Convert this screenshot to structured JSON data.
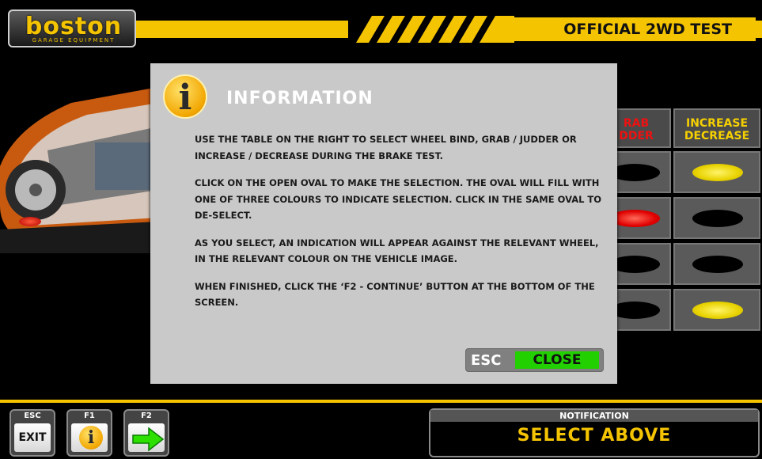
{
  "header": {
    "brand": "boston",
    "brand_sub": "GARAGE EQUIPMENT",
    "title": "OFFICIAL 2WD TEST"
  },
  "table": {
    "headers": [
      "GRAB\nJUDDER",
      "INCREASE\nDECREASE"
    ],
    "header_visible": [
      "RAB\nDDER",
      "INCREASE\nDECREASE"
    ],
    "rows": [
      {
        "grab_judder": "black",
        "increase_decrease": "yellow"
      },
      {
        "grab_judder": "red",
        "increase_decrease": "black"
      },
      {
        "grab_judder": "black",
        "increase_decrease": "black"
      },
      {
        "grab_judder": "black",
        "increase_decrease": "yellow"
      }
    ]
  },
  "dialog": {
    "icon": "info-icon",
    "title": "INFORMATION",
    "paragraphs": [
      "USE THE TABLE ON THE RIGHT TO SELECT WHEEL BIND, GRAB / JUDDER OR INCREASE / DECREASE DURING THE BRAKE TEST.",
      "CLICK ON THE OPEN OVAL TO MAKE THE SELECTION.  THE OVAL WILL FILL WITH ONE OF THREE COLOURS TO INDICATE SELECTION. CLICK IN THE SAME OVAL TO DE-SELECT.",
      "AS YOU SELECT, AN INDICATION WILL APPEAR AGAINST THE RELEVANT WHEEL, IN THE RELEVANT COLOUR ON THE VEHICLE IMAGE.",
      "WHEN FINISHED, CLICK THE ‘F2 - CONTINUE’ BUTTON AT THE BOTTOM OF THE SCREEN."
    ],
    "close_key": "ESC",
    "close_label": "CLOSE"
  },
  "footer": {
    "keys": [
      {
        "key": "ESC",
        "label": "EXIT",
        "icon": "exit"
      },
      {
        "key": "F1",
        "label": "",
        "icon": "info-icon"
      },
      {
        "key": "F2",
        "label": "",
        "icon": "arrow-right-icon"
      }
    ],
    "notification_title": "NOTIFICATION",
    "notification_message": "SELECT ABOVE"
  },
  "colors": {
    "accent": "#f5c400",
    "dialog_bg": "#c9c9c9",
    "close_green": "#22d000",
    "red": "#e00000"
  }
}
